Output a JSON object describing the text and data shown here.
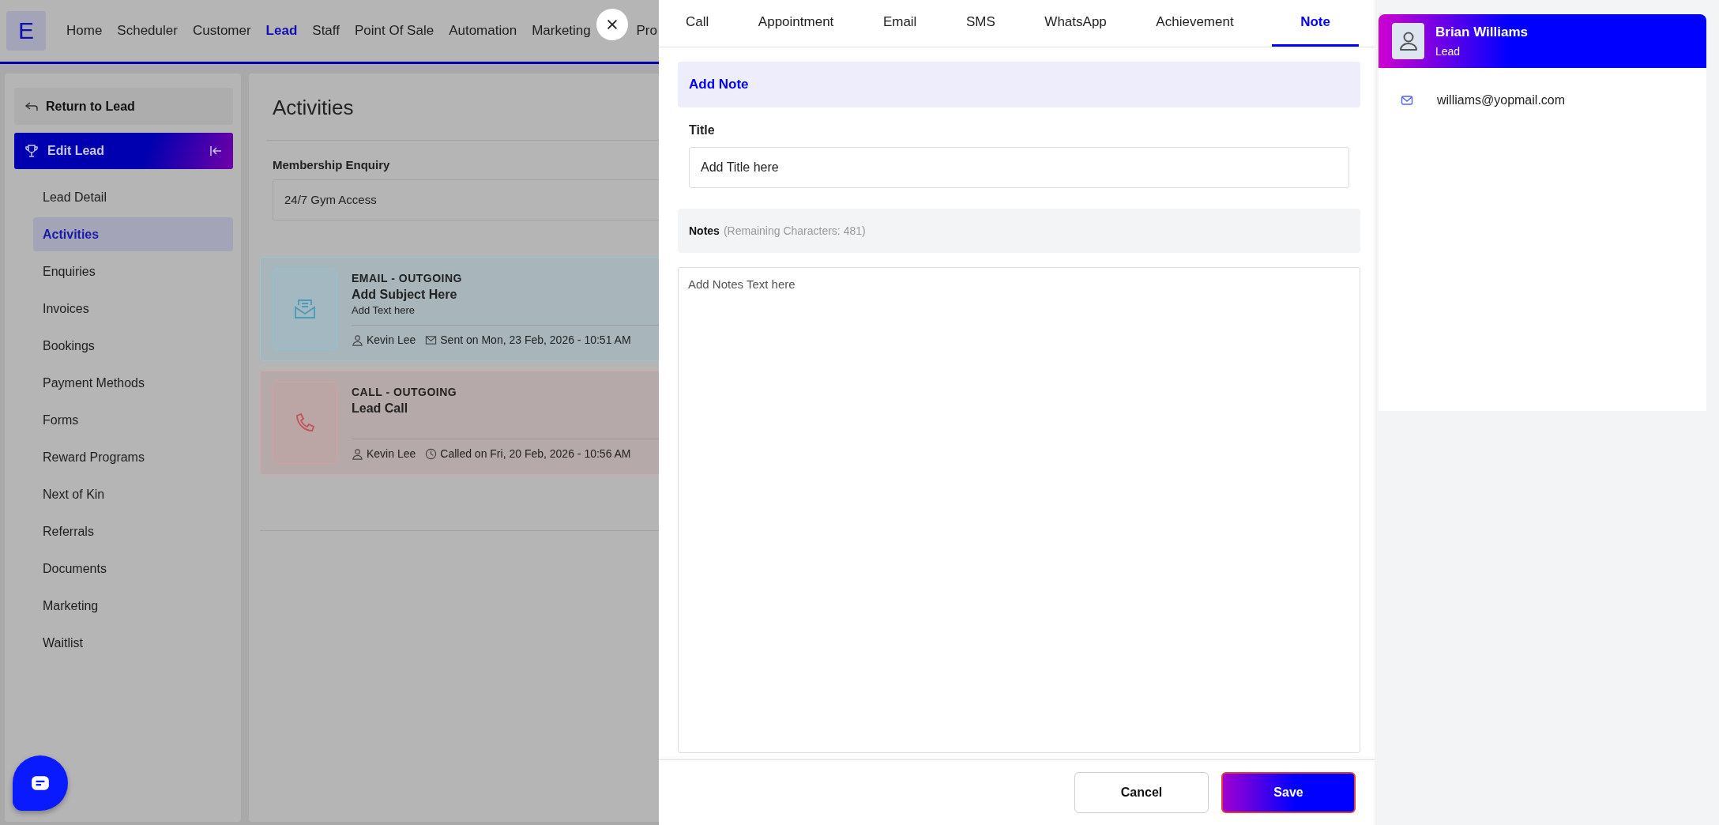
{
  "nav": {
    "logo": "E",
    "items": [
      {
        "label": "Home",
        "selected": false
      },
      {
        "label": "Scheduler",
        "selected": false
      },
      {
        "label": "Customer",
        "selected": false
      },
      {
        "label": "Lead",
        "selected": true
      },
      {
        "label": "Staff",
        "selected": false
      },
      {
        "label": "Point Of Sale",
        "selected": false
      },
      {
        "label": "Automation",
        "selected": false
      },
      {
        "label": "Marketing",
        "selected": false
      },
      {
        "label": "Pro",
        "selected": false
      }
    ]
  },
  "sidebar": {
    "return_button": "Return to Lead",
    "section_title": "Edit Lead",
    "items": [
      {
        "label": "Lead Detail",
        "selected": false
      },
      {
        "label": "Activities",
        "selected": true
      },
      {
        "label": "Enquiries",
        "selected": false
      },
      {
        "label": "Invoices",
        "selected": false
      },
      {
        "label": "Bookings",
        "selected": false
      },
      {
        "label": "Payment Methods",
        "selected": false
      },
      {
        "label": "Forms",
        "selected": false
      },
      {
        "label": "Reward Programs",
        "selected": false
      },
      {
        "label": "Next of Kin",
        "selected": false
      },
      {
        "label": "Referrals",
        "selected": false
      },
      {
        "label": "Documents",
        "selected": false
      },
      {
        "label": "Marketing",
        "selected": false
      },
      {
        "label": "Waitlist",
        "selected": false
      }
    ]
  },
  "main": {
    "title": "Activities",
    "enquiry": {
      "label": "Membership Enquiry",
      "value": "24/7 Gym Access"
    },
    "activities": [
      {
        "kind": "email",
        "type": "EMAIL - OUTGOING",
        "subject": "Add Subject Here",
        "text": "Add Text here",
        "author": "Kevin Lee",
        "timestamp": "Sent on Mon, 23 Feb, 2026 - 10:51 AM"
      },
      {
        "kind": "call",
        "type": "CALL - OUTGOING",
        "subject": "Lead Call",
        "author": "Kevin Lee",
        "timestamp": "Called on Fri, 20 Feb, 2026 - 10:56 AM"
      }
    ]
  },
  "drawer": {
    "tabs": [
      {
        "label": "Call",
        "selected": false
      },
      {
        "label": "Appointment",
        "selected": false
      },
      {
        "label": "Email",
        "selected": false
      },
      {
        "label": "SMS",
        "selected": false
      },
      {
        "label": "WhatsApp",
        "selected": false
      },
      {
        "label": "Achievement",
        "selected": false
      },
      {
        "label": "Note",
        "selected": true
      }
    ],
    "header": "Add Note",
    "title_field": {
      "label": "Title",
      "placeholder": "Add Title here"
    },
    "notes": {
      "label": "Notes",
      "hint": "(Remaining Characters: 481)",
      "placeholder": "Add Notes Text here"
    },
    "buttons": [
      {
        "kind": "cancel",
        "label": "Cancel"
      },
      {
        "kind": "save",
        "label": "Save"
      }
    ]
  },
  "contact": {
    "name": "Brian Williams",
    "role": "Lead",
    "email": "williams@yopmail.com"
  }
}
